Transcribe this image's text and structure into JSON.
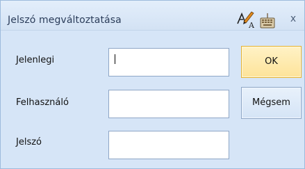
{
  "dialog": {
    "title": "Jelszó megváltoztatása",
    "icons": {
      "spellcheck": "spellcheck-icon",
      "keyboard": "keyboard-icon",
      "close": "close-icon",
      "close_glyph": "x"
    }
  },
  "form": {
    "current_label": "Jelenlegi",
    "current_value": "",
    "username_label": "Felhasználó",
    "username_value": "",
    "password_label": "Jelszó",
    "password_value": ""
  },
  "buttons": {
    "ok_label": "OK",
    "cancel_label": "Mégsem"
  },
  "colors": {
    "background": "#d6e5f7",
    "title_text": "#2b3d5a",
    "ok_button": "#fde39a",
    "field_border": "#8ea6c6"
  }
}
